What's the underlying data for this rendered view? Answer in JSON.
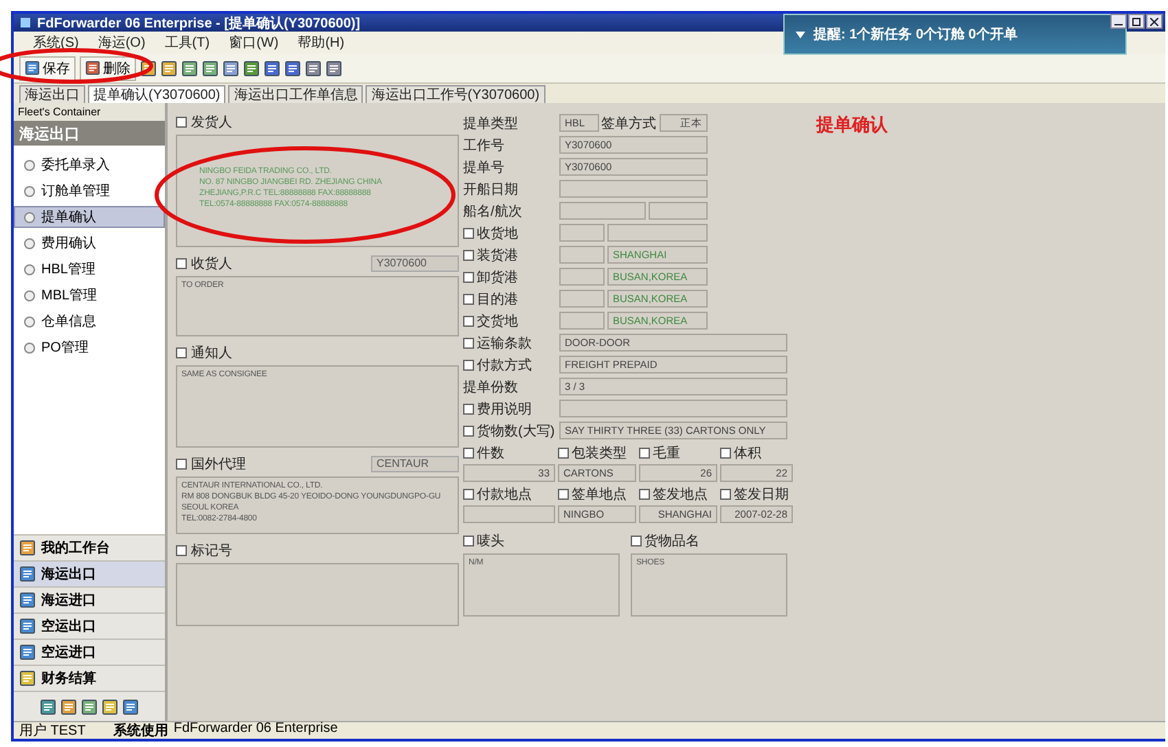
{
  "window": {
    "title": "FdForwarder 06 Enterprise - [提单确认(Y3070600)]"
  },
  "menu": [
    "系统(S)",
    "海运(O)",
    "工具(T)",
    "窗口(W)",
    "帮助(H)"
  ],
  "toolbar": {
    "buttons": [
      "保存",
      "删除"
    ]
  },
  "notification": {
    "text": "提醒: 1个新任务 0个订舱 0个开单"
  },
  "tabs": [
    {
      "label": "海运出口",
      "selected": false
    },
    {
      "label": "提单确认(Y3070600)",
      "selected": true
    },
    {
      "label": "海运出口工作单信息",
      "selected": false
    },
    {
      "label": "海运出口工作号(Y3070600)",
      "selected": false
    }
  ],
  "sidebar": {
    "header": "Fleet's Container",
    "section": "海运出口",
    "items": [
      {
        "label": "委托单录入",
        "selected": false
      },
      {
        "label": "订舱单管理",
        "selected": false
      },
      {
        "label": "提单确认",
        "selected": true
      },
      {
        "label": "费用确认",
        "selected": false
      },
      {
        "label": "HBL管理",
        "selected": false
      },
      {
        "label": "MBL管理",
        "selected": false
      },
      {
        "label": "仓单信息",
        "selected": false
      },
      {
        "label": "PO管理",
        "selected": false
      }
    ],
    "groups": [
      {
        "label": "我的工作台",
        "selected": false
      },
      {
        "label": "海运出口",
        "selected": true
      },
      {
        "label": "海运进口",
        "selected": false
      },
      {
        "label": "空运出口",
        "selected": false
      },
      {
        "label": "空运进口",
        "selected": false
      },
      {
        "label": "财务结算",
        "selected": false
      }
    ]
  },
  "form": {
    "title": "提单确认",
    "parties": [
      {
        "label": "发货人",
        "checked": false,
        "lines": [
          "NINGBO FEIDA TRADING CO., LTD.",
          "NO. 87 NINGBO JIANGBEI RD. ZHEJIANG CHINA",
          "ZHEJIANG,P.R.C TEL:88888888 FAX:88888888",
          "TEL:0574-88888888 FAX:0574-88888888"
        ]
      },
      {
        "label": "收货人",
        "checked": false,
        "code": "Y3070600",
        "lines": [
          "TO ORDER"
        ]
      },
      {
        "label": "通知人",
        "checked": false,
        "lines": [
          "SAME AS CONSIGNEE"
        ]
      },
      {
        "label": "国外代理",
        "checked": false,
        "code": "CENTAUR",
        "lines": [
          "CENTAUR INTERNATIONAL CO., LTD.",
          "RM 808 DONGBUK BLDG 45-20 YEOIDO-DONG YOUNGDUNGPO-GU",
          "SEOUL KOREA",
          "TEL:0082-2784-4800"
        ]
      },
      {
        "label": "标记号",
        "checked": false
      }
    ],
    "rows": [
      {
        "kind": "header",
        "label": "提单类型",
        "value": "HBL",
        "label2": "签单方式",
        "value2": "正本"
      },
      {
        "kind": "field",
        "label": "工作号",
        "values": [
          "Y3070600"
        ]
      },
      {
        "kind": "field",
        "label": "提单号",
        "values": [
          "Y3070600"
        ]
      },
      {
        "kind": "field",
        "label": "开船日期",
        "values": []
      },
      {
        "kind": "split",
        "label": "船名/航次",
        "values": []
      },
      {
        "kind": "port",
        "label": "收货地",
        "checked": false,
        "values": []
      },
      {
        "kind": "port",
        "label": "装货港",
        "checked": false,
        "values": [
          "SHANGHAI"
        ]
      },
      {
        "kind": "port",
        "label": "卸货港",
        "checked": false,
        "values": [
          "BUSAN,KOREA"
        ]
      },
      {
        "kind": "port",
        "label": "目的港",
        "checked": false,
        "values": [
          "BUSAN,KOREA"
        ]
      },
      {
        "kind": "port",
        "label": "交货地",
        "checked": false,
        "values": [
          "BUSAN,KOREA"
        ]
      },
      {
        "kind": "wide",
        "label": "运输条款",
        "checked": false,
        "values": [
          "DOOR-DOOR"
        ]
      },
      {
        "kind": "wide",
        "label": "付款方式",
        "checked": false,
        "values": [
          "FREIGHT PREPAID"
        ]
      },
      {
        "kind": "wide",
        "label": "提单份数",
        "values": [
          "3 / 3"
        ]
      },
      {
        "kind": "wide",
        "label": "费用说明",
        "checked": false,
        "values": []
      },
      {
        "kind": "wide",
        "label": "货物数(大写)",
        "checked": false,
        "values": [
          "SAY THIRTY THREE (33) CARTONS ONLY"
        ]
      }
    ],
    "grids": [
      [
        {
          "label": "件数",
          "checked": false,
          "value": "33"
        },
        {
          "label": "包装类型",
          "checked": false,
          "value": "CARTONS"
        },
        {
          "label": "毛重",
          "checked": false,
          "value": "26"
        },
        {
          "label": "体积",
          "checked": false,
          "value": "22"
        }
      ],
      [
        {
          "label": "付款地点",
          "checked": false
        },
        {
          "label": "签单地点",
          "checked": false,
          "value": "NINGBO"
        },
        {
          "label": "签发地点",
          "checked": false,
          "value": "SHANGHAI"
        },
        {
          "label": "签发日期",
          "checked": false,
          "value": "2007-02-28"
        }
      ]
    ],
    "bottom": [
      {
        "label": "唛头",
        "checked": false,
        "value": "N/M"
      },
      {
        "label": "货物品名",
        "checked": false,
        "value": "SHOES"
      }
    ]
  },
  "status_bar": {
    "user": "用户 TEST",
    "system_label": "系统使用",
    "product": "FdForwarder 06 Enterprise"
  }
}
